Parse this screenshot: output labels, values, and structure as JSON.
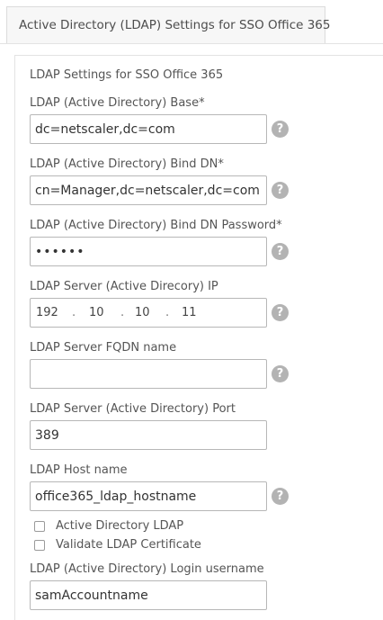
{
  "tab": {
    "label": "Active Directory (LDAP) Settings for SSO Office 365"
  },
  "section": {
    "title": "LDAP Settings for SSO Office 365"
  },
  "fields": {
    "base": {
      "label": "LDAP (Active Directory) Base*",
      "value": "dc=netscaler,dc=com"
    },
    "bind_dn": {
      "label": "LDAP (Active Directory) Bind DN*",
      "value": "cn=Manager,dc=netscaler,dc=com"
    },
    "bind_dn_password": {
      "label": "LDAP (Active Directory) Bind DN Password*",
      "value": "••••••"
    },
    "server_ip": {
      "label": "LDAP Server (Active Direcory) IP",
      "octets": [
        "192",
        "10",
        "10",
        "11"
      ]
    },
    "server_fqdn": {
      "label": "LDAP Server FQDN name",
      "value": ""
    },
    "server_port": {
      "label": "LDAP Server (Active Directory) Port",
      "value": "389"
    },
    "host_name": {
      "label": "LDAP Host name",
      "value": "office365_ldap_hostname"
    },
    "login_username": {
      "label": "LDAP (Active Directory) Login username",
      "value": "samAccountname"
    }
  },
  "checkboxes": {
    "active_directory_ldap": {
      "label": "Active Directory LDAP",
      "checked": false
    },
    "validate_certificate": {
      "label": "Validate LDAP Certificate",
      "checked": false
    }
  },
  "help_icon": {
    "glyph": "?",
    "color": "#b3b3b3"
  }
}
